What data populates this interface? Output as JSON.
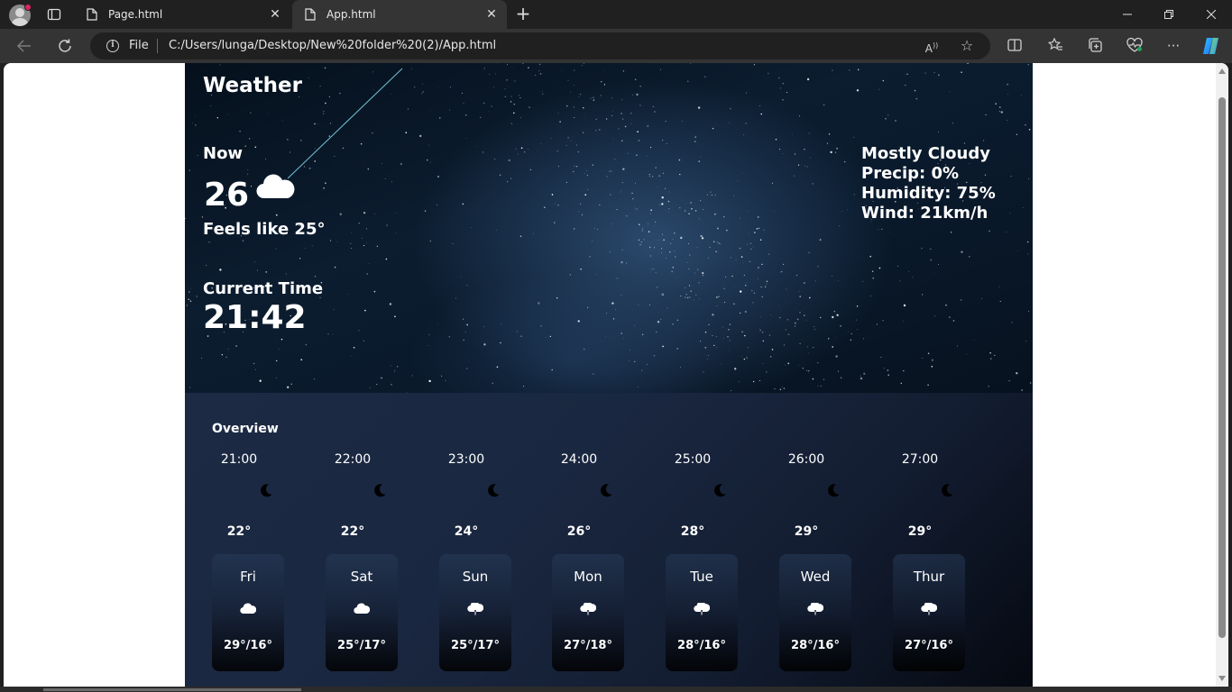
{
  "browser": {
    "tabs": [
      {
        "title": "Page.html",
        "active": false
      },
      {
        "title": "App.html",
        "active": true
      }
    ],
    "address": {
      "protocol_label": "File",
      "url": "C:/Users/lunga/Desktop/New%20folder%20(2)/App.html"
    }
  },
  "app": {
    "title": "Weather",
    "now_label": "Now",
    "temperature": "26",
    "weather_icon": "cloud-icon",
    "feels_like": "Feels like 25°",
    "time_label": "Current Time",
    "time": "21:42",
    "details": {
      "condition": "Mostly Cloudy",
      "precip": "Precip: 0%",
      "humidity": "Humidity: 75%",
      "wind": "Wind: 21km/h"
    },
    "overview": {
      "title": "Overview",
      "hourly": [
        {
          "time": "21:00",
          "icon": "moon-icon",
          "temp": "22°"
        },
        {
          "time": "22:00",
          "icon": "moon-icon",
          "temp": "22°"
        },
        {
          "time": "23:00",
          "icon": "moon-icon",
          "temp": "24°"
        },
        {
          "time": "24:00",
          "icon": "moon-icon",
          "temp": "26°"
        },
        {
          "time": "25:00",
          "icon": "moon-icon",
          "temp": "28°"
        },
        {
          "time": "26:00",
          "icon": "moon-icon",
          "temp": "29°"
        },
        {
          "time": "27:00",
          "icon": "moon-icon",
          "temp": "29°"
        }
      ],
      "daily": [
        {
          "day": "Fri",
          "icon": "cloud-icon",
          "temps": "29°/16°"
        },
        {
          "day": "Sat",
          "icon": "cloud-icon",
          "temps": "25°/17°"
        },
        {
          "day": "Sun",
          "icon": "cloud-rain-icon",
          "temps": "25°/17°"
        },
        {
          "day": "Mon",
          "icon": "cloud-rain-icon",
          "temps": "27°/18°"
        },
        {
          "day": "Tue",
          "icon": "cloud-rain-icon",
          "temps": "28°/16°"
        },
        {
          "day": "Wed",
          "icon": "cloud-rain-icon",
          "temps": "28°/16°"
        },
        {
          "day": "Thur",
          "icon": "cloud-rain-icon",
          "temps": "27°/16°"
        }
      ]
    }
  }
}
